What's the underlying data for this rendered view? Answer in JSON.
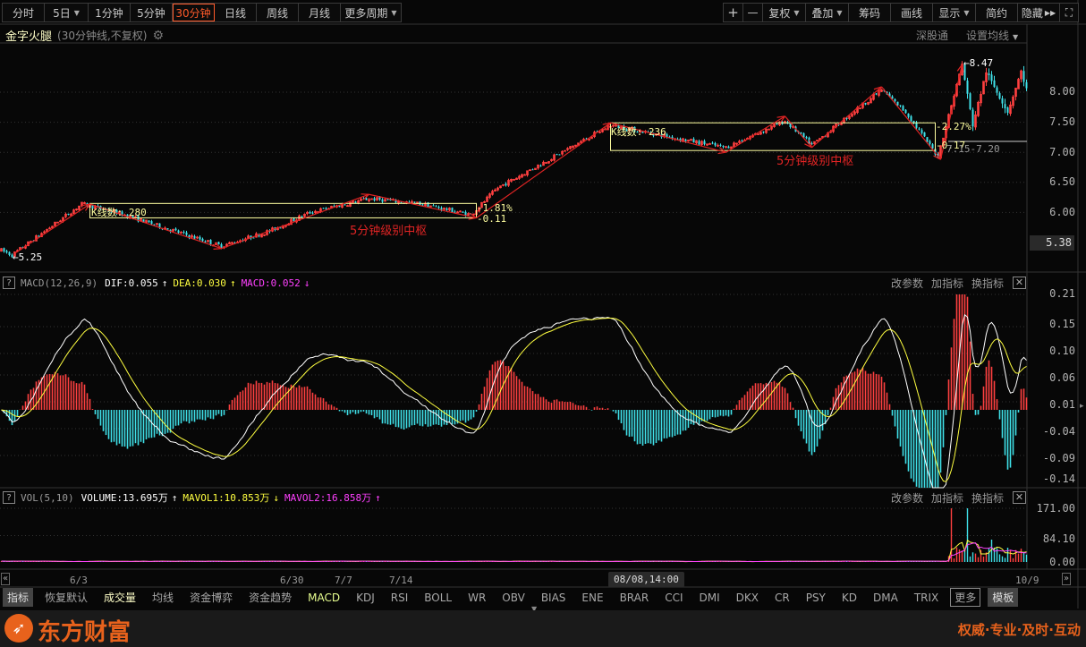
{
  "toolbar": {
    "periods": [
      "分时",
      "5日",
      "1分钟",
      "5分钟",
      "30分钟",
      "日线",
      "周线",
      "月线",
      "更多周期"
    ],
    "right": [
      "+",
      "—",
      "复权",
      "叠加",
      "筹码",
      "画线",
      "显示",
      "简约",
      "隐藏"
    ]
  },
  "title": {
    "name": "金字火腿",
    "sub": "(30分钟线,不复权)",
    "sgt": "深股通",
    "ma": "设置均线"
  },
  "main": {
    "price_axis": [
      "8.00",
      "7.50",
      "7.00",
      "6.50",
      "6.00"
    ],
    "last_price": "5.38",
    "labels": {
      "low": "5.25",
      "high": "8.47",
      "box1_count": "K线数: 280",
      "box2_count": "K线数: 236",
      "box1_name": "5分钟级别中枢",
      "box2_name": "5分钟级别中枢",
      "box1_pct": "-1.81%",
      "box1_diff": "-0.11",
      "box2_pct": "-2.27%",
      "box2_diff": "-0.17",
      "range": "7.15-7.20"
    }
  },
  "panel_actions": [
    "改参数",
    "加指标",
    "换指标"
  ],
  "macd": {
    "name": "MACD(12,26,9)",
    "dif": "DIF:0.055",
    "dea": "DEA:0.030",
    "macd": "MACD:0.052",
    "axis": [
      "0.21",
      "0.15",
      "0.10",
      "0.06",
      "0.01",
      "-0.04",
      "-0.09",
      "-0.14"
    ]
  },
  "vol": {
    "name": "VOL(5,10)",
    "volume": "VOLUME:13.695万",
    "mavol1": "MAVOL1:10.853万",
    "mavol2": "MAVOL2:16.858万",
    "axis": [
      "171.00",
      "84.10",
      "0.00"
    ]
  },
  "dates": [
    "6/3",
    "6/30",
    "7/7",
    "7/14",
    "10/9"
  ],
  "crosshair_time": "08/08,14:00",
  "indicators": [
    "指标",
    "恢复默认",
    "成交量",
    "均线",
    "资金博弈",
    "资金趋势",
    "MACD",
    "KDJ",
    "RSI",
    "BOLL",
    "WR",
    "OBV",
    "BIAS",
    "ENE",
    "BRAR",
    "CCI",
    "DMI",
    "DKX",
    "CR",
    "PSY",
    "KD",
    "DMA",
    "TRIX",
    "更多",
    "模板"
  ],
  "footer": {
    "brand": "东方财富",
    "slogan": "权威·专业·及时·互动"
  },
  "colors": {
    "up": "#ff4040",
    "down": "#3fe0e8",
    "dif": "#ffffff",
    "dea": "#ffff40",
    "mavol2": "#ff40ff",
    "accent": "#ff5a2a",
    "annot": "#e02424",
    "box": "#ffffa0"
  },
  "chart_data": {
    "type": "candlestick",
    "bars": 383,
    "price_anchors": [
      [
        0,
        5.37
      ],
      [
        4,
        5.29
      ],
      [
        30,
        6.14
      ],
      [
        43,
        6.0
      ],
      [
        82,
        5.44
      ],
      [
        100,
        5.69
      ],
      [
        115,
        6.0
      ],
      [
        137,
        6.23
      ],
      [
        157,
        6.14
      ],
      [
        175,
        5.96
      ],
      [
        185,
        6.41
      ],
      [
        200,
        6.78
      ],
      [
        227,
        7.45
      ],
      [
        253,
        7.22
      ],
      [
        270,
        7.08
      ],
      [
        292,
        7.52
      ],
      [
        302,
        7.12
      ],
      [
        328,
        8.04
      ],
      [
        337,
        7.67
      ],
      [
        349,
        6.93
      ],
      [
        358,
        8.46
      ],
      [
        362,
        7.45
      ],
      [
        367,
        8.34
      ],
      [
        375,
        7.67
      ],
      [
        380,
        8.34
      ],
      [
        382,
        8.05
      ]
    ],
    "zigzag": [
      [
        5,
        5.32
      ],
      [
        33,
        6.14
      ],
      [
        82,
        5.4
      ],
      [
        137,
        6.3
      ],
      [
        177,
        5.91
      ],
      [
        227,
        7.49
      ],
      [
        270,
        7.0
      ],
      [
        292,
        7.6
      ],
      [
        302,
        7.08
      ],
      [
        328,
        8.09
      ],
      [
        350,
        6.88
      ],
      [
        358,
        8.46
      ]
    ],
    "boxes": [
      [
        33,
        177,
        5.91,
        6.15
      ],
      [
        227,
        348,
        7.03,
        7.49
      ]
    ],
    "price_range": [
      5.2,
      8.6
    ],
    "macd_range": [
      -0.14,
      0.21
    ],
    "vol_range": [
      0,
      171
    ]
  }
}
